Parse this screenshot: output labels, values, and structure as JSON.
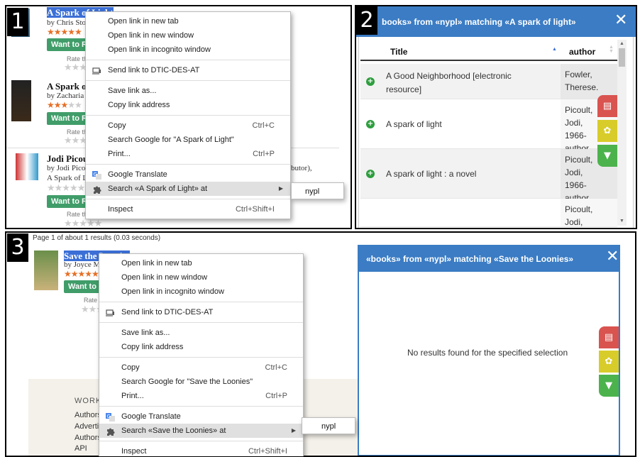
{
  "badges": [
    "1",
    "2",
    "3"
  ],
  "panel1": {
    "books": [
      {
        "title": "A Spark of Light",
        "author_prefix": "by Chris Sto",
        "want": "Want to R",
        "rate": "Rate th"
      },
      {
        "title": "A Spark o",
        "author_prefix": "by Zacharia",
        "want": "Want to R",
        "rate": "Rate th"
      },
      {
        "title": "Jodi Picou",
        "author_prefix": "by Jodi Pico",
        "extra": "A Spark of L",
        "tail": "butor),",
        "want": "Want to R",
        "rate": "Rate th"
      }
    ],
    "menu": {
      "items": [
        {
          "label": "Open link in new tab"
        },
        {
          "label": "Open link in new window"
        },
        {
          "label": "Open link in incognito window"
        },
        {
          "sep": true
        },
        {
          "label": "Send link to DTIC-DES-AT",
          "icon": "device-icon"
        },
        {
          "sep": true
        },
        {
          "label": "Save link as..."
        },
        {
          "label": "Copy link address"
        },
        {
          "sep": true
        },
        {
          "label": "Copy",
          "shortcut": "Ctrl+C"
        },
        {
          "label": "Search Google for \"A Spark of Light\""
        },
        {
          "label": "Print...",
          "shortcut": "Ctrl+P"
        },
        {
          "sep": true
        },
        {
          "label": "Google Translate",
          "icon": "translate-icon"
        },
        {
          "label": "Search «A Spark of Light» at",
          "icon": "puzzle-icon",
          "highlight": true,
          "arrow": "▶"
        },
        {
          "sep": true
        },
        {
          "label": "Inspect",
          "shortcut": "Ctrl+Shift+I"
        }
      ],
      "submenu": "nypl"
    }
  },
  "panel2": {
    "title": "books» from «nypl» matching «A spark of light»",
    "columns": {
      "title": "Title",
      "author": "author"
    },
    "sort_indicator": "▲",
    "rows": [
      {
        "title": "A Good Neighborhood [electronic resource]",
        "author": "Fowler, Therese."
      },
      {
        "title": "A spark of light",
        "author": "Picoult, Jodi, 1966- author."
      },
      {
        "title": "A spark of light : a novel",
        "author": "Picoult, Jodi, 1966- author."
      },
      {
        "title": "",
        "author": "Picoult, Jodi, 1966-"
      }
    ]
  },
  "panel3": {
    "page_info": "Page 1 of about 1 results (0.03 seconds)",
    "book": {
      "title": "Save the Loonies",
      "author_prefix": "by Joyce Mi",
      "want": "Want to R",
      "rate": "Rate th"
    },
    "footer": {
      "heading": "WORK",
      "links": [
        "Authors",
        "Adverti",
        "Authors",
        "API"
      ]
    },
    "menu": {
      "items": [
        {
          "label": "Open link in new tab"
        },
        {
          "label": "Open link in new window"
        },
        {
          "label": "Open link in incognito window"
        },
        {
          "sep": true
        },
        {
          "label": "Send link to DTIC-DES-AT",
          "icon": "device-icon"
        },
        {
          "sep": true
        },
        {
          "label": "Save link as..."
        },
        {
          "label": "Copy link address"
        },
        {
          "sep": true
        },
        {
          "label": "Copy",
          "shortcut": "Ctrl+C"
        },
        {
          "label": "Search Google for \"Save the Loonies\""
        },
        {
          "label": "Print...",
          "shortcut": "Ctrl+P"
        },
        {
          "sep": true
        },
        {
          "label": "Google Translate",
          "icon": "translate-icon"
        },
        {
          "label": "Search «Save the Loonies» at",
          "icon": "puzzle-icon",
          "highlight": true,
          "arrow": "▶"
        },
        {
          "sep": true
        },
        {
          "label": "Inspect",
          "shortcut": "Ctrl+Shift+I"
        }
      ],
      "submenu": "nypl"
    },
    "dialog": {
      "title": "«books» from «nypl» matching «Save the Loonies»",
      "empty": "No results found for the specified selection"
    }
  },
  "icons": {
    "close": "✕",
    "plus": "+",
    "book": "▤",
    "gear": "✿",
    "filter": "▼"
  },
  "colors": {
    "header": "#3b7cc4",
    "red": "#d9534f",
    "yellow": "#d8cc2a",
    "green": "#4cb34c"
  }
}
